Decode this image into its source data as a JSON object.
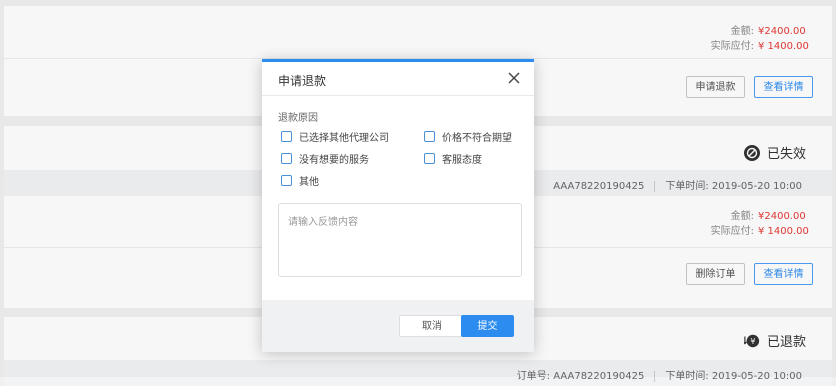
{
  "orders": [
    {
      "amount_label": "金额:",
      "amount_value": "¥2400.00",
      "payable_label": "实际应付:",
      "payable_value": "¥ 1400.00",
      "buttons": [
        "申请退款",
        "查看详情"
      ]
    },
    {
      "status": "已失效",
      "order_no": "AAA78220190425",
      "order_time": "下单时间: 2019-05-20 10:00",
      "amount_label": "金额:",
      "amount_value": "¥2400.00",
      "payable_label": "实际应付:",
      "payable_value": "¥ 1400.00",
      "buttons": [
        "删除订单",
        "查看详情"
      ]
    },
    {
      "status": "已退款",
      "order_no_label": "订单号:",
      "order_no": "AAA78220190425",
      "order_time": "下单时间: 2019-05-20 10:00"
    }
  ],
  "modal": {
    "title": "申请退款",
    "reason_label": "退款原因",
    "options": [
      "已选择其他代理公司",
      "价格不符合期望",
      "没有想要的服务",
      "客服态度",
      "其他"
    ],
    "textarea_placeholder": "请输入反馈内容",
    "cancel_label": "取消",
    "submit_label": "提交"
  },
  "colors": {
    "accent": "#2d8cf0",
    "price": "#e53935"
  }
}
